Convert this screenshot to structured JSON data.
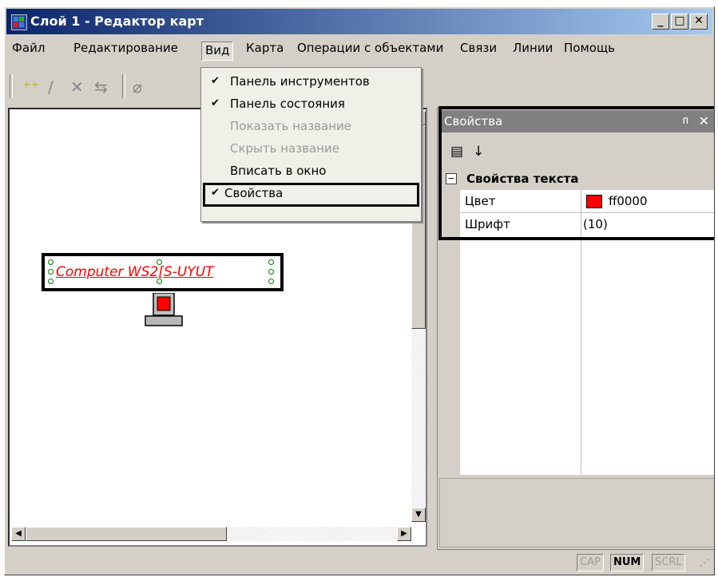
{
  "window": {
    "title": "Слой 1 - Редактор карт",
    "min_glyph": "_",
    "max_glyph": "□",
    "close_glyph": "✕"
  },
  "menu": [
    "Файл",
    "Редактирование",
    "Вид",
    "Карта",
    "Операции с объектами",
    "Связи",
    "Линии",
    "Помощь"
  ],
  "view_menu": {
    "items": [
      {
        "label": "Панель инструментов",
        "checked": true,
        "enabled": true
      },
      {
        "label": "Панель состояния",
        "checked": true,
        "enabled": true
      },
      {
        "label": "Показать название",
        "checked": false,
        "enabled": false
      },
      {
        "label": "Скрыть название",
        "checked": false,
        "enabled": false
      },
      {
        "label": "Вписать в окно",
        "checked": false,
        "enabled": true
      },
      {
        "label": "Свойства",
        "checked": true,
        "enabled": true
      }
    ],
    "check_glyph": "✔"
  },
  "toolbar": {
    "icons": [
      "add-point-icon",
      "line-icon",
      "delete-icon",
      "link-icon",
      "eraser-icon"
    ]
  },
  "map": {
    "object_label": "Computer  WS2[S-UYUT"
  },
  "properties": {
    "title": "Свойства",
    "pin_glyph": "ᴨ",
    "close_glyph": "✕",
    "category": "Свойства текста",
    "collapse_glyph": "−",
    "rows": [
      {
        "name": "Цвет",
        "value": "ff0000",
        "swatch": "#ff0000"
      },
      {
        "name": "Шрифт",
        "value": "(10)"
      }
    ]
  },
  "statusbar": {
    "indicators": [
      {
        "label": "CAP",
        "on": false
      },
      {
        "label": "NUM",
        "on": true
      },
      {
        "label": "SCRL",
        "on": false
      }
    ]
  },
  "colors": {
    "titlebar_start": "#0a246a",
    "titlebar_end": "#a6caf0",
    "object_text": "#ff0000"
  }
}
